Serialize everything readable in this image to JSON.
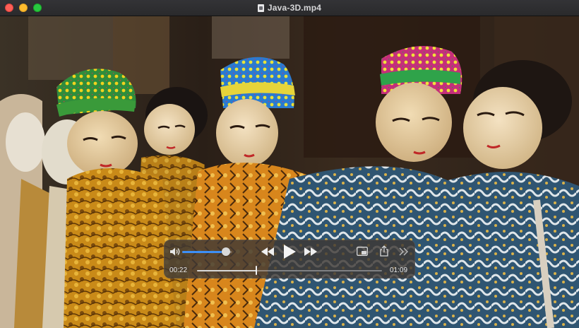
{
  "window": {
    "title": "Java-3D.mp4",
    "title_icon": "document-icon"
  },
  "video": {
    "scene": "wooden-puppets"
  },
  "controller": {
    "volume_level": 0.88,
    "elapsed": "00:22",
    "total": "01:09",
    "progress": 0.32,
    "icons": [
      "speaker-icon",
      "rewind-icon",
      "play-icon",
      "fast-forward-icon",
      "picture-in-picture-icon",
      "share-icon",
      "more-icon"
    ],
    "accent_color": "#3d8ff6"
  }
}
